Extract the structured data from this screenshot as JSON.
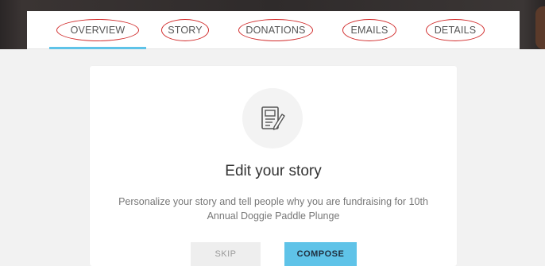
{
  "tabs": [
    {
      "label": "OVERVIEW",
      "active": true
    },
    {
      "label": "STORY",
      "active": false
    },
    {
      "label": "DONATIONS",
      "active": false
    },
    {
      "label": "EMAILS",
      "active": false
    },
    {
      "label": "DETAILS",
      "active": false
    }
  ],
  "card": {
    "icon": "edit-document-icon",
    "heading": "Edit your story",
    "description": "Personalize your story and tell people why you are fundraising for 10th Annual Doggie Paddle Plunge"
  },
  "buttons": {
    "skip_label": "SKIP",
    "compose_label": "COMPOSE"
  },
  "colors": {
    "accent": "#5fc3e8",
    "annotation": "#d12a2a"
  }
}
